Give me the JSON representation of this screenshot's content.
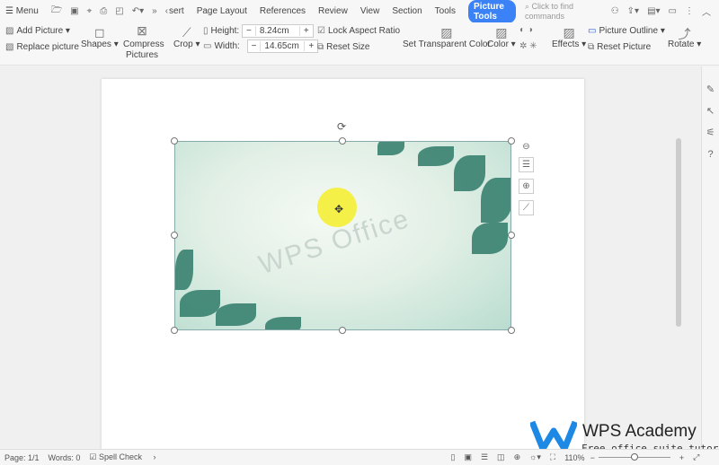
{
  "menubar": {
    "menu": "Menu",
    "tabs": [
      "sert",
      "Page Layout",
      "References",
      "Review",
      "View",
      "Section",
      "Tools"
    ],
    "active_tab": "Picture Tools",
    "search_placeholder": "Click to find commands"
  },
  "ribbon": {
    "add_picture": "Add Picture",
    "replace_picture": "Replace picture",
    "shapes": "Shapes",
    "compress": "Compress Pictures",
    "crop": "Crop",
    "height_label": "Height:",
    "height_value": "8.24cm",
    "width_label": "Width:",
    "width_value": "14.65cm",
    "lock_aspect": "Lock Aspect Ratio",
    "reset_size": "Reset Size",
    "set_transparent": "Set Transparent Color",
    "color": "Color",
    "effects": "Effects",
    "picture_outline": "Picture Outline",
    "reset_picture": "Reset Picture",
    "rotate": "Rotate"
  },
  "document": {
    "watermark": "WPS Office"
  },
  "status": {
    "page": "Page: 1/1",
    "words": "Words: 0",
    "spell_check": "Spell Check",
    "zoom": "110%",
    "zoom_fraction": 0.5
  },
  "brand": {
    "title": "WPS Academy",
    "subtitle": "Free office suite tutorials"
  }
}
